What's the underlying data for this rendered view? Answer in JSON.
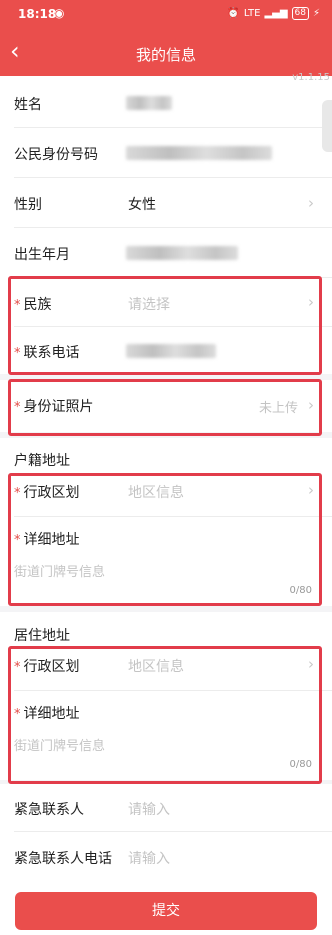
{
  "status_bar": {
    "time": "18:18",
    "network": "LTE",
    "battery": "68"
  },
  "nav": {
    "title": "我的信息",
    "back_icon": "chevron-left-icon"
  },
  "version": "v1.1.15",
  "basic": {
    "name_label": "姓名",
    "id_label": "公民身份号码",
    "gender_label": "性别",
    "gender_value": "女性",
    "birth_label": "出生年月",
    "ethnicity_label": "民族",
    "ethnicity_placeholder": "请选择",
    "phone_label": "联系电话"
  },
  "id_photo": {
    "label": "身份证照片",
    "status": "未上传"
  },
  "household": {
    "title": "户籍地址",
    "district_label": "行政区划",
    "district_placeholder": "地区信息",
    "detail_label": "详细地址",
    "detail_placeholder": "街道门牌号信息",
    "counter": "0/80"
  },
  "residence": {
    "title": "居住地址",
    "district_label": "行政区划",
    "district_placeholder": "地区信息",
    "detail_label": "详细地址",
    "detail_placeholder": "街道门牌号信息",
    "counter": "0/80"
  },
  "emergency": {
    "contact_label": "紧急联系人",
    "contact_placeholder": "请输入",
    "phone_label": "紧急联系人电话",
    "phone_placeholder": "请输入"
  },
  "required_mark": "*",
  "chevron": "›",
  "submit_label": "提交",
  "colors": {
    "brand": "#ea4e4c",
    "highlight_box": "#e23c4a",
    "required": "#e24b47"
  }
}
